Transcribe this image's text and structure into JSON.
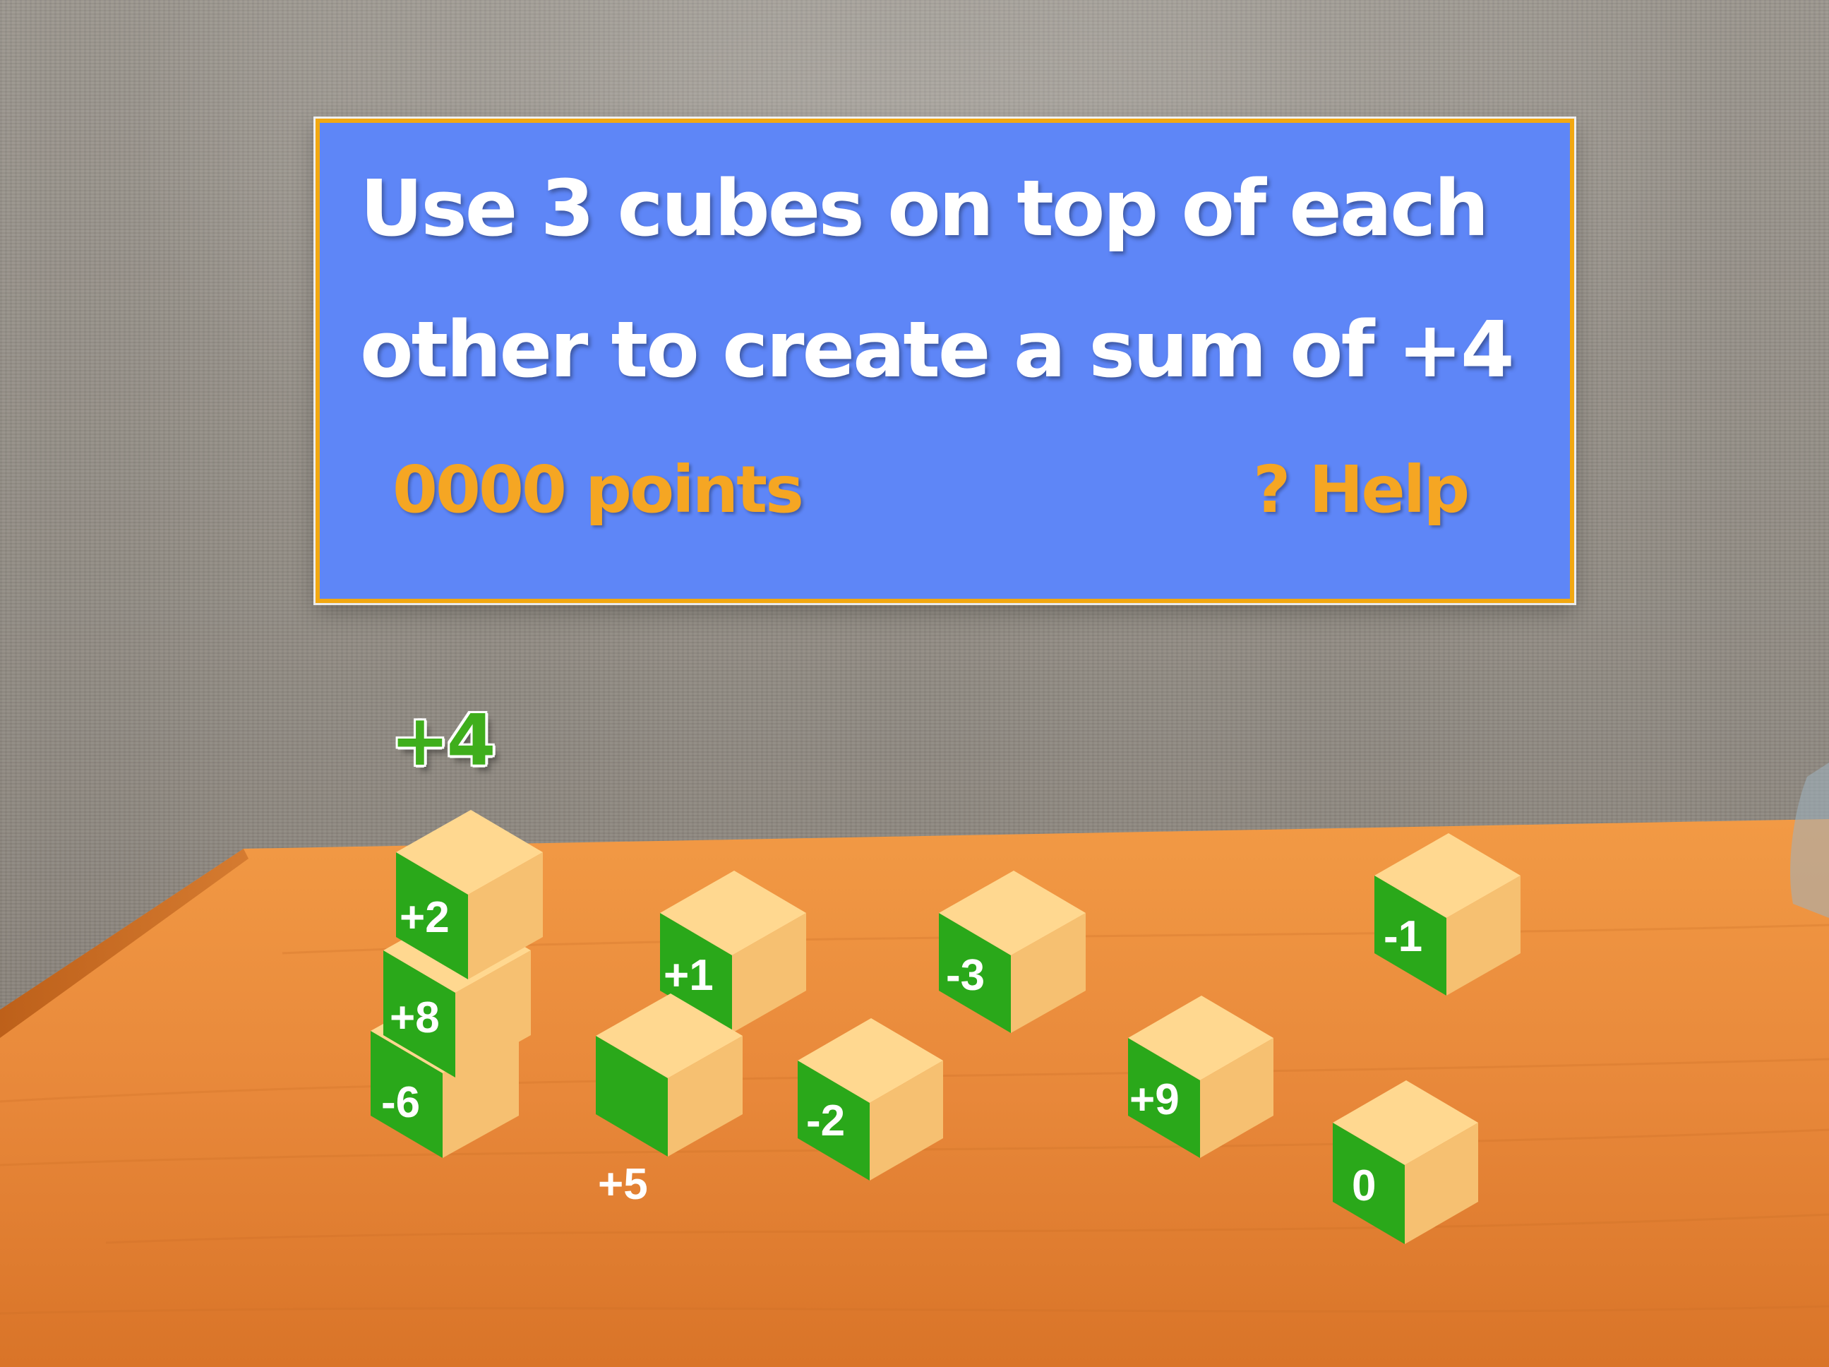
{
  "instruction": {
    "line1": "Use 3 cubes on top of each",
    "line2": "other to create a sum of +4"
  },
  "score": {
    "label": "0000 points"
  },
  "help": {
    "label": "? Help"
  },
  "stack": {
    "sum_label": "+4"
  },
  "cubes": {
    "stack_bottom": "-6",
    "stack_middle": "+8",
    "stack_top": "+2",
    "c1": "+1",
    "c2": "-3",
    "c3": "-1",
    "c4": "+5",
    "c5": "-2",
    "c6": "+9",
    "c7": "0"
  },
  "colors": {
    "panel": "#5e86f7",
    "panel_border": "#f2a811",
    "cube_green": "#2aa81a",
    "cube_orange": "#ffca74",
    "accent_orange": "#f5a623",
    "table": "#e78a34"
  }
}
